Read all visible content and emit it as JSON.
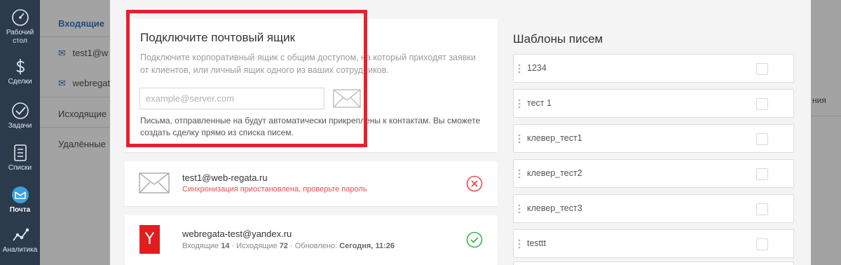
{
  "nav": {
    "items": [
      {
        "label": "Рабочий стол",
        "icon": "dashboard-icon"
      },
      {
        "label": "Сделки",
        "icon": "dollar-icon"
      },
      {
        "label": "Задачи",
        "icon": "check-icon"
      },
      {
        "label": "Списки",
        "icon": "list-icon"
      },
      {
        "label": "Почта",
        "icon": "mail-icon"
      },
      {
        "label": "Аналитика",
        "icon": "analytics-icon"
      }
    ],
    "dash_label": "Рабочий\nстол"
  },
  "underlying": {
    "inbox_header": "Входящие",
    "mailbox1": "test1@w",
    "mailbox2": "webregata",
    "outgoing": "Исходящие",
    "deleted": "Удалённые",
    "right_fragment": "ния"
  },
  "connect": {
    "title": "Подключите почтовый ящик",
    "description": "Подключите корпоративный ящик с общим доступом, на который приходят заявки от клиентов, или личный ящик одного из ваших сотрудников.",
    "email_placeholder": "example@server.com",
    "note": "Письма, отправленные на будут автоматически прикреплены к контактам. Вы сможете создать сделку прямо из списка писем."
  },
  "mailboxes": [
    {
      "address": "test1@web-regata.ru",
      "status_text": "Синхронизация приостановлена, проверьте пароль",
      "status": "error"
    },
    {
      "address": "webregata-test@yandex.ru",
      "provider_letter": "Y",
      "inbox_label": "Входящие",
      "inbox_count": "14",
      "outbox_label": "Исходящие",
      "outbox_count": "72",
      "updated_label": "Обновлено:",
      "updated_value": "Сегодня, 11:26",
      "status": "ok"
    }
  ],
  "templates": {
    "title": "Шаблоны писем",
    "items": [
      "1234",
      "тест 1",
      "клевер_тест1",
      "клевер_тест2",
      "клевер_тест3",
      "testtt"
    ]
  },
  "colors": {
    "sidebar": "#2b3b4b",
    "highlight": "#e8202f",
    "error": "#e84c4c",
    "ok": "#3fb34f",
    "yandex": "#e01e1e"
  }
}
